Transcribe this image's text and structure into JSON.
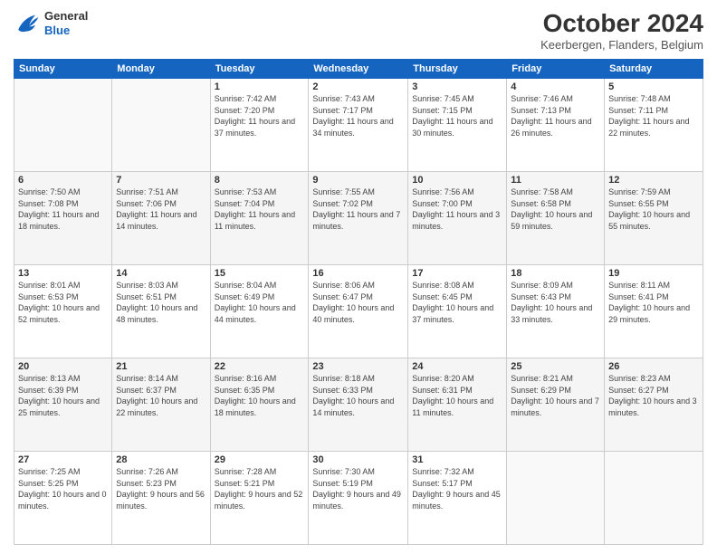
{
  "logo": {
    "general": "General",
    "blue": "Blue"
  },
  "header": {
    "month": "October 2024",
    "location": "Keerbergen, Flanders, Belgium"
  },
  "weekdays": [
    "Sunday",
    "Monday",
    "Tuesday",
    "Wednesday",
    "Thursday",
    "Friday",
    "Saturday"
  ],
  "weeks": [
    [
      {
        "day": null,
        "info": null
      },
      {
        "day": null,
        "info": null
      },
      {
        "day": "1",
        "info": "Sunrise: 7:42 AM\nSunset: 7:20 PM\nDaylight: 11 hours and 37 minutes."
      },
      {
        "day": "2",
        "info": "Sunrise: 7:43 AM\nSunset: 7:17 PM\nDaylight: 11 hours and 34 minutes."
      },
      {
        "day": "3",
        "info": "Sunrise: 7:45 AM\nSunset: 7:15 PM\nDaylight: 11 hours and 30 minutes."
      },
      {
        "day": "4",
        "info": "Sunrise: 7:46 AM\nSunset: 7:13 PM\nDaylight: 11 hours and 26 minutes."
      },
      {
        "day": "5",
        "info": "Sunrise: 7:48 AM\nSunset: 7:11 PM\nDaylight: 11 hours and 22 minutes."
      }
    ],
    [
      {
        "day": "6",
        "info": "Sunrise: 7:50 AM\nSunset: 7:08 PM\nDaylight: 11 hours and 18 minutes."
      },
      {
        "day": "7",
        "info": "Sunrise: 7:51 AM\nSunset: 7:06 PM\nDaylight: 11 hours and 14 minutes."
      },
      {
        "day": "8",
        "info": "Sunrise: 7:53 AM\nSunset: 7:04 PM\nDaylight: 11 hours and 11 minutes."
      },
      {
        "day": "9",
        "info": "Sunrise: 7:55 AM\nSunset: 7:02 PM\nDaylight: 11 hours and 7 minutes."
      },
      {
        "day": "10",
        "info": "Sunrise: 7:56 AM\nSunset: 7:00 PM\nDaylight: 11 hours and 3 minutes."
      },
      {
        "day": "11",
        "info": "Sunrise: 7:58 AM\nSunset: 6:58 PM\nDaylight: 10 hours and 59 minutes."
      },
      {
        "day": "12",
        "info": "Sunrise: 7:59 AM\nSunset: 6:55 PM\nDaylight: 10 hours and 55 minutes."
      }
    ],
    [
      {
        "day": "13",
        "info": "Sunrise: 8:01 AM\nSunset: 6:53 PM\nDaylight: 10 hours and 52 minutes."
      },
      {
        "day": "14",
        "info": "Sunrise: 8:03 AM\nSunset: 6:51 PM\nDaylight: 10 hours and 48 minutes."
      },
      {
        "day": "15",
        "info": "Sunrise: 8:04 AM\nSunset: 6:49 PM\nDaylight: 10 hours and 44 minutes."
      },
      {
        "day": "16",
        "info": "Sunrise: 8:06 AM\nSunset: 6:47 PM\nDaylight: 10 hours and 40 minutes."
      },
      {
        "day": "17",
        "info": "Sunrise: 8:08 AM\nSunset: 6:45 PM\nDaylight: 10 hours and 37 minutes."
      },
      {
        "day": "18",
        "info": "Sunrise: 8:09 AM\nSunset: 6:43 PM\nDaylight: 10 hours and 33 minutes."
      },
      {
        "day": "19",
        "info": "Sunrise: 8:11 AM\nSunset: 6:41 PM\nDaylight: 10 hours and 29 minutes."
      }
    ],
    [
      {
        "day": "20",
        "info": "Sunrise: 8:13 AM\nSunset: 6:39 PM\nDaylight: 10 hours and 25 minutes."
      },
      {
        "day": "21",
        "info": "Sunrise: 8:14 AM\nSunset: 6:37 PM\nDaylight: 10 hours and 22 minutes."
      },
      {
        "day": "22",
        "info": "Sunrise: 8:16 AM\nSunset: 6:35 PM\nDaylight: 10 hours and 18 minutes."
      },
      {
        "day": "23",
        "info": "Sunrise: 8:18 AM\nSunset: 6:33 PM\nDaylight: 10 hours and 14 minutes."
      },
      {
        "day": "24",
        "info": "Sunrise: 8:20 AM\nSunset: 6:31 PM\nDaylight: 10 hours and 11 minutes."
      },
      {
        "day": "25",
        "info": "Sunrise: 8:21 AM\nSunset: 6:29 PM\nDaylight: 10 hours and 7 minutes."
      },
      {
        "day": "26",
        "info": "Sunrise: 8:23 AM\nSunset: 6:27 PM\nDaylight: 10 hours and 3 minutes."
      }
    ],
    [
      {
        "day": "27",
        "info": "Sunrise: 7:25 AM\nSunset: 5:25 PM\nDaylight: 10 hours and 0 minutes."
      },
      {
        "day": "28",
        "info": "Sunrise: 7:26 AM\nSunset: 5:23 PM\nDaylight: 9 hours and 56 minutes."
      },
      {
        "day": "29",
        "info": "Sunrise: 7:28 AM\nSunset: 5:21 PM\nDaylight: 9 hours and 52 minutes."
      },
      {
        "day": "30",
        "info": "Sunrise: 7:30 AM\nSunset: 5:19 PM\nDaylight: 9 hours and 49 minutes."
      },
      {
        "day": "31",
        "info": "Sunrise: 7:32 AM\nSunset: 5:17 PM\nDaylight: 9 hours and 45 minutes."
      },
      {
        "day": null,
        "info": null
      },
      {
        "day": null,
        "info": null
      }
    ]
  ]
}
